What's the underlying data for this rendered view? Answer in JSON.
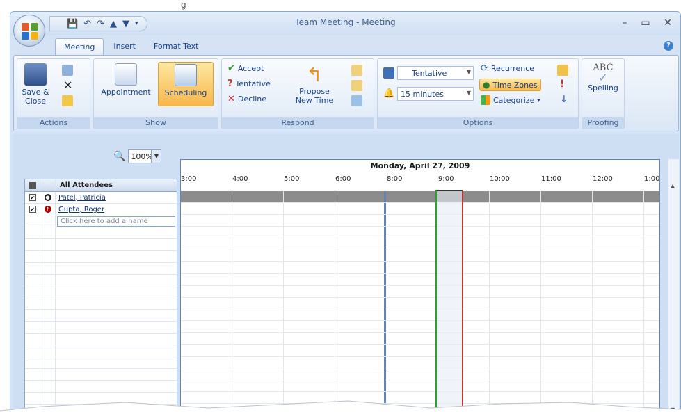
{
  "window": {
    "title": "Team Meeting - Meeting"
  },
  "title_bar_fragment": "g",
  "controls": {
    "minimize": "–",
    "maximize": "▭",
    "close": "✕"
  },
  "tabs": [
    "Meeting",
    "Insert",
    "Format Text"
  ],
  "ribbon": {
    "actions": {
      "save_close": "Save & Close",
      "label": "Actions"
    },
    "show": {
      "appointment": "Appointment",
      "scheduling": "Scheduling",
      "label": "Show"
    },
    "respond": {
      "accept": "Accept",
      "tentative": "Tentative",
      "decline": "Decline",
      "propose": "Propose New Time",
      "label": "Respond"
    },
    "options": {
      "show_as": "Tentative",
      "reminder": "15 minutes",
      "recurrence": "Recurrence",
      "time_zones": "Time Zones",
      "categorize": "Categorize",
      "label": "Options"
    },
    "proofing": {
      "spelling": "Spelling",
      "label": "Proofing"
    }
  },
  "zoom": "100%",
  "schedule": {
    "date": "Monday, April 27, 2009",
    "hours": [
      "3:00",
      "4:00",
      "5:00",
      "6:00",
      "8:00",
      "9:00",
      "10:00",
      "11:00",
      "12:00",
      "1:00"
    ]
  },
  "attendees": {
    "header": "All Attendees",
    "rows": [
      {
        "name": "Patel, Patricia",
        "checked": true,
        "role": "organizer"
      },
      {
        "name": "Gupta, Roger",
        "checked": true,
        "role": "required"
      }
    ],
    "add_placeholder": "Click here to add a name"
  }
}
